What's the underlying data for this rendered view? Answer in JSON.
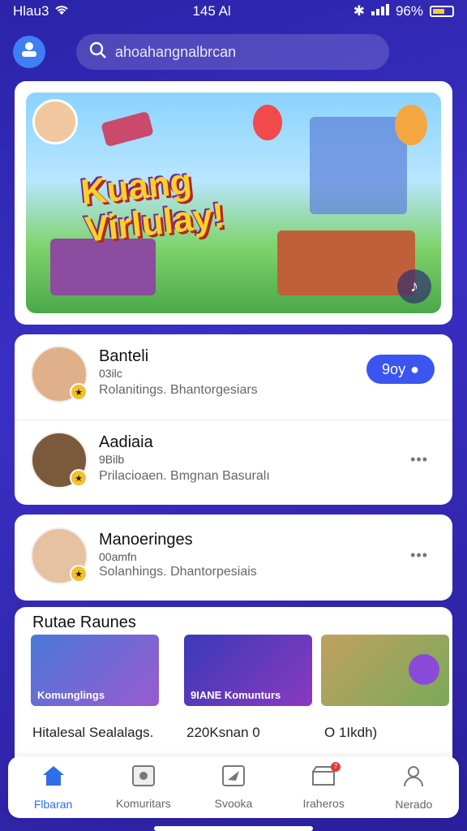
{
  "status_bar": {
    "carrier": "Hlau3",
    "time": "145 Al",
    "battery": "96%"
  },
  "search": {
    "placeholder": "ahoahangnalbrcan"
  },
  "hero": {
    "title_line1": "Kuang",
    "title_line2": "Virlulay!"
  },
  "list": [
    {
      "name": "Banteli",
      "meta": "03ilc",
      "desc": "Rolanitings. Bhantorgesiars",
      "action_label": "9oy"
    },
    {
      "name": "Aadiaia",
      "meta": "9Bilb",
      "desc": "Prilacioaen. Bmgnan Basuralı"
    },
    {
      "name": "Manoeringes",
      "meta": "00amfn",
      "desc": "Solanhings. Dhantorpesiais"
    }
  ],
  "section": {
    "title": "Rutae Raunes",
    "thumbs": [
      {
        "label": "Komunglings"
      },
      {
        "label": "9IANE Komunturs"
      },
      {
        "label": ""
      }
    ],
    "stats": {
      "left": "Hitalesal Sealalags.",
      "mid": "220Ksnan 0",
      "right": "O 1Ikdh)"
    }
  },
  "tabs": [
    {
      "label": "Flbaran",
      "icon": "home-icon"
    },
    {
      "label": "Komuritars",
      "icon": "camera-icon"
    },
    {
      "label": "Svooka",
      "icon": "send-icon"
    },
    {
      "label": "Iraheros",
      "icon": "store-icon",
      "badge": "7"
    },
    {
      "label": "Nerado",
      "icon": "profile-icon"
    }
  ],
  "colors": {
    "accent": "#3b55f0",
    "background": "#2b23a8"
  }
}
